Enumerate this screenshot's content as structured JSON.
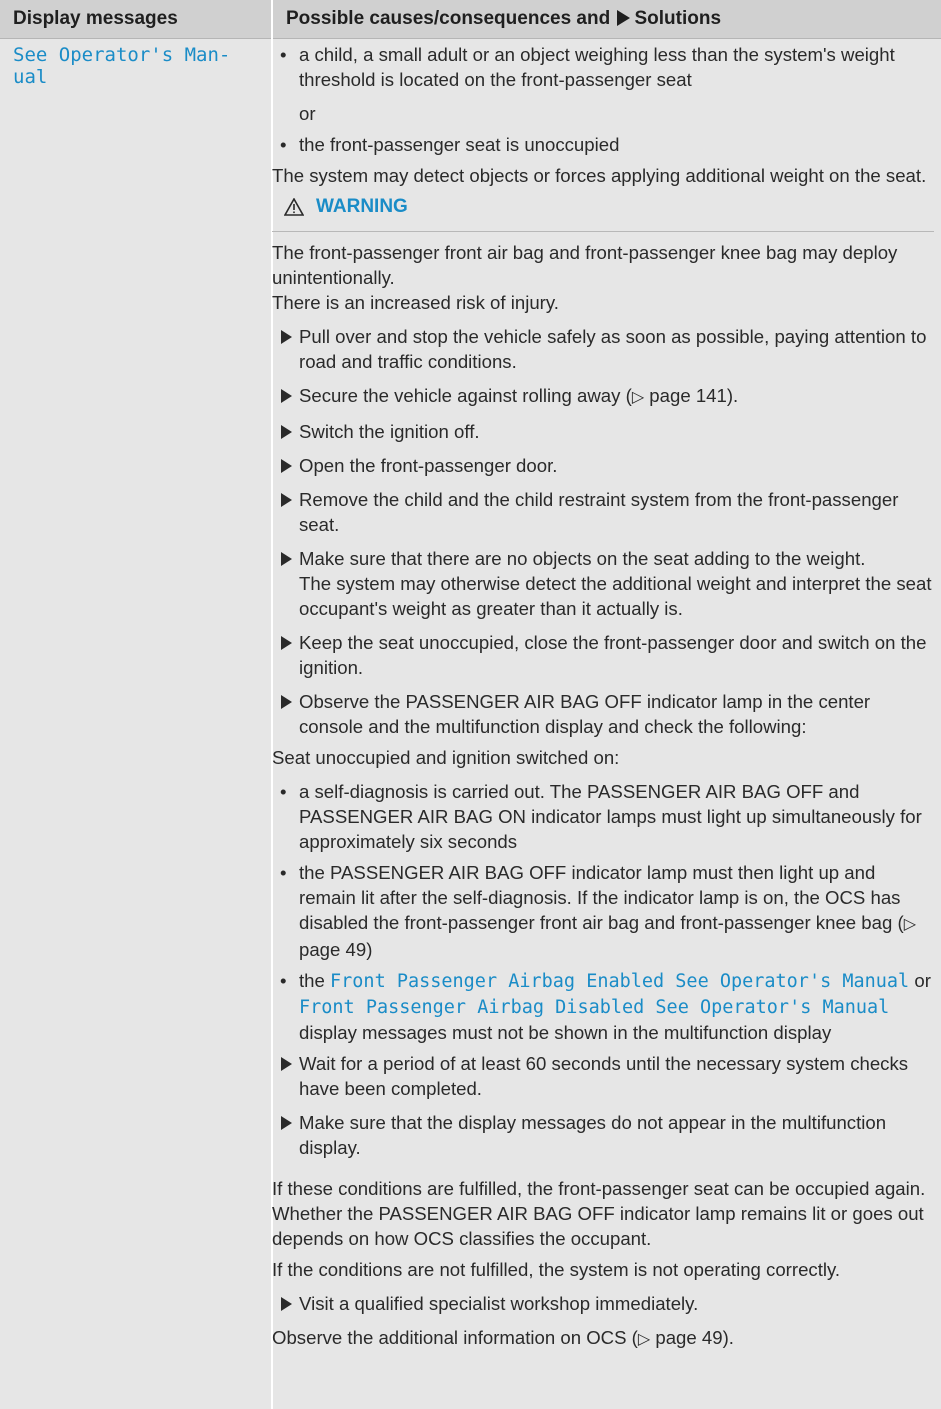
{
  "header": {
    "col1": "Display messages",
    "col2_prefix": "Possible causes/consequences and",
    "col2_suffix": "Solutions"
  },
  "message": "See Operator's Man-\nual",
  "content": {
    "b1": "a child, a small adult or an object weighing less than the system's weight threshold is located on the front-passenger seat",
    "or": "or",
    "b2": "the front-passenger seat is unoccupied",
    "p1": "The system may detect objects or forces applying additional weight on the seat.",
    "warning_title": "WARNING",
    "w1": "The front-passenger front air bag and front-passenger knee bag may deploy unintentionally.",
    "w2": "There is an increased risk of injury.",
    "s1": "Pull over and stop the vehicle safely as soon as possible, paying attention to road and traffic conditions.",
    "s2_a": "Secure the vehicle against rolling away (",
    "s2_ref": "▷",
    "s2_b": " page 141).",
    "s3": "Switch the ignition off.",
    "s4": "Open the front-passenger door.",
    "s5": "Remove the child and the child restraint system from the front-passenger seat.",
    "s6": "Make sure that there are no objects on the seat adding to the weight.",
    "s6_note": "The system may otherwise detect the additional weight and interpret the seat occupant's weight as greater than it actually is.",
    "s7": "Keep the seat unoccupied, close the front-passenger door and switch on the ignition.",
    "s8": "Observe the PASSENGER AIR BAG OFF indicator lamp in the center console and the multifunction display and check the following:",
    "p2": "Seat unoccupied and ignition switched on:",
    "b3": "a self-diagnosis is carried out. The PASSENGER AIR BAG OFF and PASSENGER AIR BAG ON indicator lamps must light up simultaneously for approximately six seconds",
    "b4_a": "the PASSENGER AIR BAG OFF indicator lamp must then light up and remain lit after the self-diagnosis. If the indicator lamp is on, the OCS has disabled the front-passenger front air bag and front-passenger knee bag (",
    "b4_ref": "▷",
    "b4_b": " page 49)",
    "b5_a": "the ",
    "b5_m1": "Front Passenger Airbag Enabled See Operator's Manual",
    "b5_mid": " or ",
    "b5_m2": "Front Passenger Airbag Disabled See Operator's Manual",
    "b5_b": " display messages must not be shown in the multifunction display",
    "s9": "Wait for a period of at least 60 seconds until the necessary system checks have been completed.",
    "s10": "Make sure that the display messages do not appear in the multifunction display.",
    "p3": "If these conditions are fulfilled, the front-passenger seat can be occupied again. Whether the PASSENGER AIR BAG OFF indicator lamp remains lit or goes out depends on how OCS classifies the occupant.",
    "p4": "If the conditions are not fulfilled, the system is not operating correctly.",
    "s11": "Visit a qualified specialist workshop immediately.",
    "p5_a": "Observe the additional information on OCS (",
    "p5_ref": "▷",
    "p5_b": " page 49)."
  },
  "colors": {
    "header_bg": "#d0d0d0",
    "body_bg": "#e6e6e6",
    "accent": "#1a8cc7"
  }
}
